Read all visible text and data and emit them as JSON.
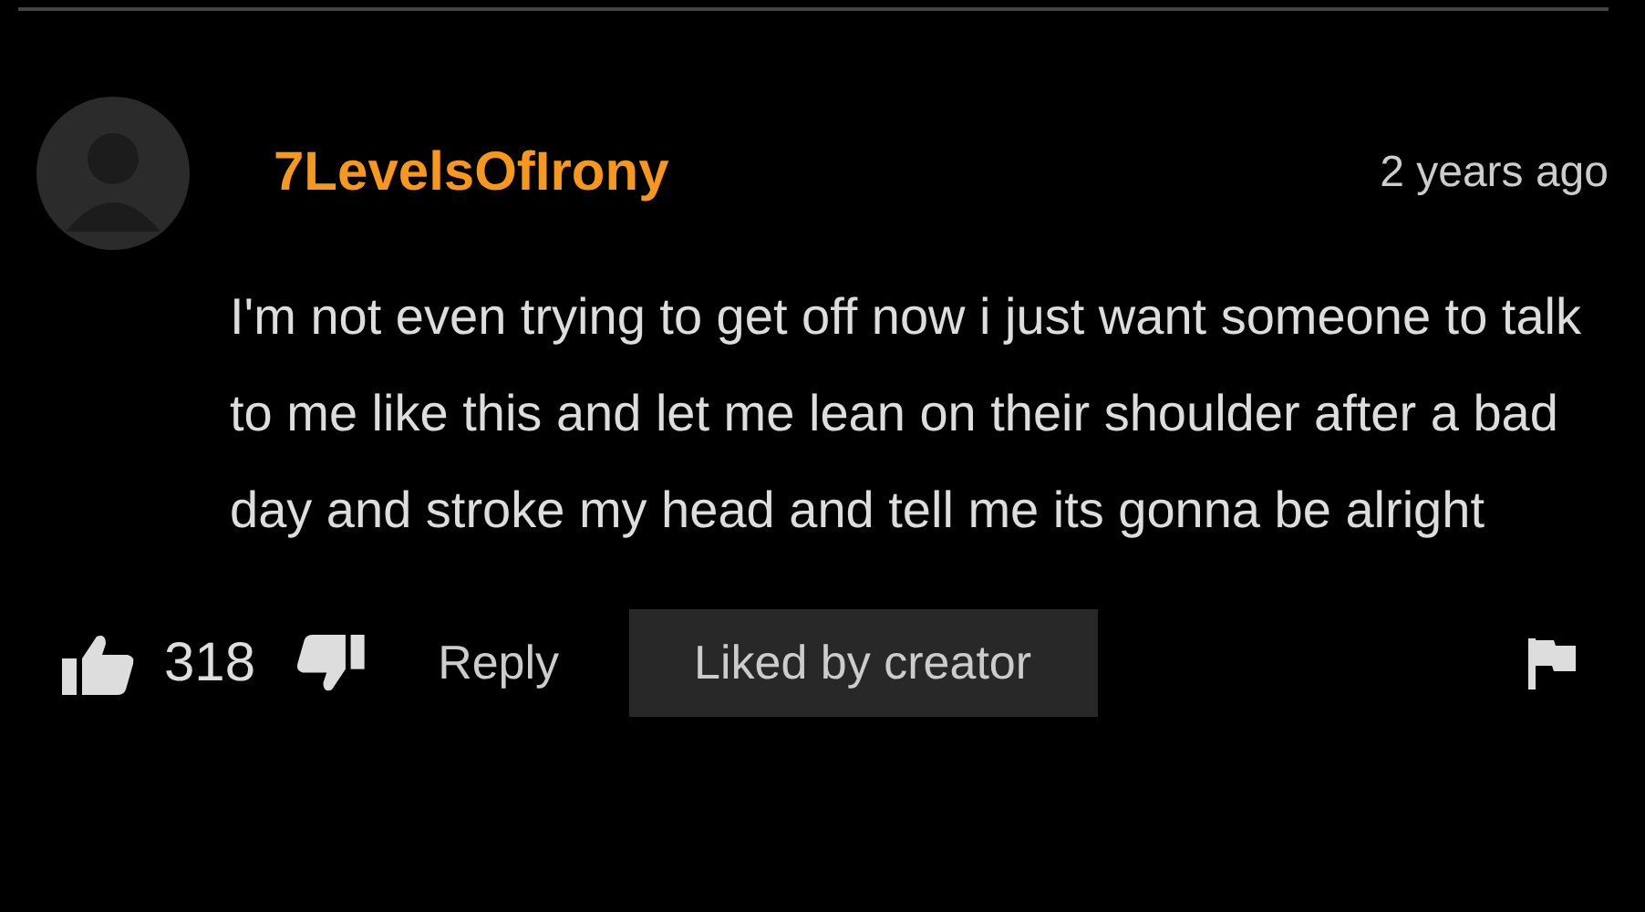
{
  "comment": {
    "username": "7LevelsOfIrony",
    "time": "2 years ago",
    "text": "I'm not even trying to get off now i just want someone to talk to me like this and let me lean on their shoulder after a bad day and stroke my head and tell me its gonna be alright",
    "likes": "318",
    "reply": "Reply",
    "badge": "Liked by creator"
  }
}
